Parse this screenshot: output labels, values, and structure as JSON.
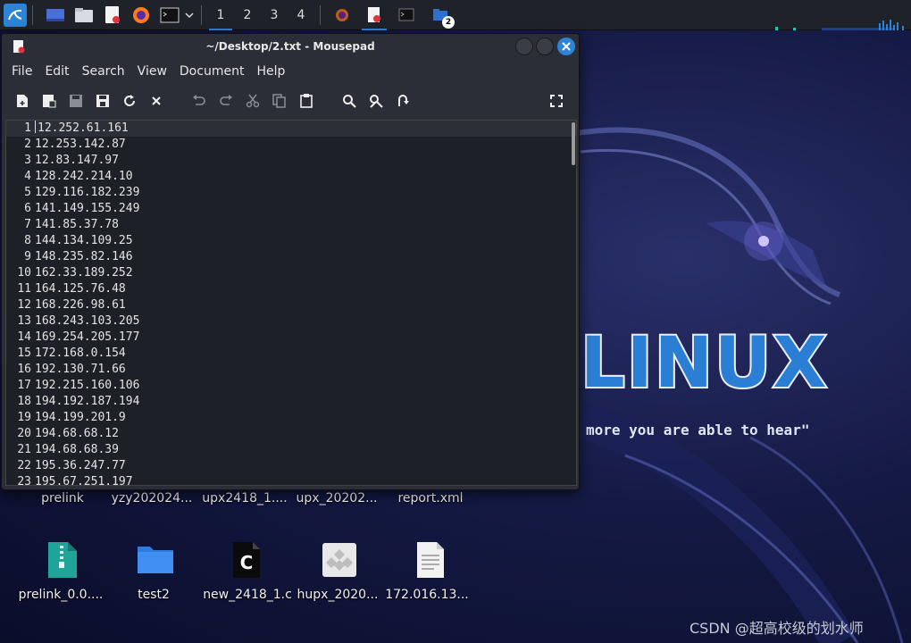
{
  "taskbar": {
    "workspaces": [
      "1",
      "2",
      "3",
      "4"
    ],
    "active_workspace": "1",
    "window_badge": "2"
  },
  "window": {
    "title": "~/Desktop/2.txt - Mousepad",
    "menu": [
      "File",
      "Edit",
      "Search",
      "View",
      "Document",
      "Help"
    ],
    "lines": [
      {
        "n": "1",
        "t": "12.252.61.161"
      },
      {
        "n": "2",
        "t": "12.253.142.87"
      },
      {
        "n": "3",
        "t": "12.83.147.97"
      },
      {
        "n": "4",
        "t": "128.242.214.10"
      },
      {
        "n": "5",
        "t": "129.116.182.239"
      },
      {
        "n": "6",
        "t": "141.149.155.249"
      },
      {
        "n": "7",
        "t": "141.85.37.78"
      },
      {
        "n": "8",
        "t": "144.134.109.25"
      },
      {
        "n": "9",
        "t": "148.235.82.146"
      },
      {
        "n": "10",
        "t": "162.33.189.252"
      },
      {
        "n": "11",
        "t": "164.125.76.48"
      },
      {
        "n": "12",
        "t": "168.226.98.61"
      },
      {
        "n": "13",
        "t": "168.243.103.205"
      },
      {
        "n": "14",
        "t": "169.254.205.177"
      },
      {
        "n": "15",
        "t": "172.168.0.154"
      },
      {
        "n": "16",
        "t": "192.130.71.66"
      },
      {
        "n": "17",
        "t": "192.215.160.106"
      },
      {
        "n": "18",
        "t": "194.192.187.194"
      },
      {
        "n": "19",
        "t": "194.199.201.9"
      },
      {
        "n": "20",
        "t": "194.68.68.12"
      },
      {
        "n": "21",
        "t": "194.68.68.39"
      },
      {
        "n": "22",
        "t": "195.36.247.77"
      },
      {
        "n": "23",
        "t": "195.67.251.197"
      }
    ]
  },
  "desktop": {
    "row1_labels": [
      "prelink",
      "yzy202024...",
      "upx2418_1....",
      "upx_20202...",
      "report.xml"
    ],
    "row2_labels": [
      "prelink_0.0....",
      "test2",
      "new_2418_1.c",
      "hupx_2020...",
      "172.016.13..."
    ],
    "wallpaper_title": "LINUX",
    "wallpaper_slogan": "more you are able to hear\"",
    "watermark": "CSDN @超高校级的划水师"
  },
  "colors": {
    "accent": "#2e83d6",
    "close_button": "#2e83d6"
  }
}
